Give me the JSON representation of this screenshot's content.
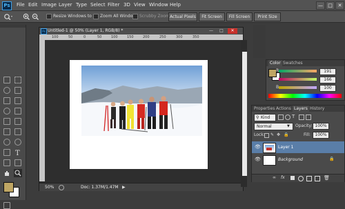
{
  "app": {
    "logo": "Ps"
  },
  "menu": [
    "File",
    "Edit",
    "Image",
    "Layer",
    "Type",
    "Select",
    "Filter",
    "3D",
    "View",
    "Window",
    "Help"
  ],
  "window_controls": {
    "minimize": "—",
    "restore": "□",
    "close": "✕"
  },
  "options_bar": {
    "resize_windows_label": "Resize Windows to Fit",
    "zoom_all_label": "Zoom All Windows",
    "scrubby_label": "Scrubby Zoom",
    "actual_pixels": "Actual Pixels",
    "fit_screen": "Fit Screen",
    "fill_screen": "Fill Screen",
    "print_size": "Print Size"
  },
  "document": {
    "title": "Untitled-1 @ 50% (Layer 1, RGB/8) *",
    "controls": {
      "minimize": "—",
      "restore": "□",
      "close": "✕"
    },
    "ruler_labels": [
      "100",
      "50",
      "0",
      "50",
      "100",
      "150",
      "200",
      "250",
      "300",
      "350"
    ],
    "zoom": "50%",
    "doc_info": "Doc: 1.37M/1.47M"
  },
  "color_panel": {
    "tabs": [
      "Color",
      "Swatches"
    ],
    "channels": [
      {
        "name": "R",
        "value": "191"
      },
      {
        "name": "G",
        "value": "166"
      },
      {
        "name": "B",
        "value": "100"
      }
    ],
    "fg_color": "#bfa664",
    "bg_color": "#ffffff"
  },
  "layers_panel": {
    "tabs": [
      "Properties",
      "Actions",
      "Layers",
      "History"
    ],
    "kind_label": "Kind",
    "blend_mode": "Normal",
    "opacity_label": "Opacity:",
    "opacity_value": "100%",
    "lock_label": "Lock:",
    "fill_label": "Fill:",
    "fill_value": "100%",
    "layers": [
      {
        "name": "Layer 1",
        "selected": true
      },
      {
        "name": "Background",
        "selected": false
      }
    ]
  },
  "colors": {
    "accent": "#31a8ff",
    "panel_bg": "#4a4a4a",
    "chrome_bg": "#535353",
    "workspace_bg": "#3c3c3c",
    "selected_layer": "#5a7ea8"
  }
}
